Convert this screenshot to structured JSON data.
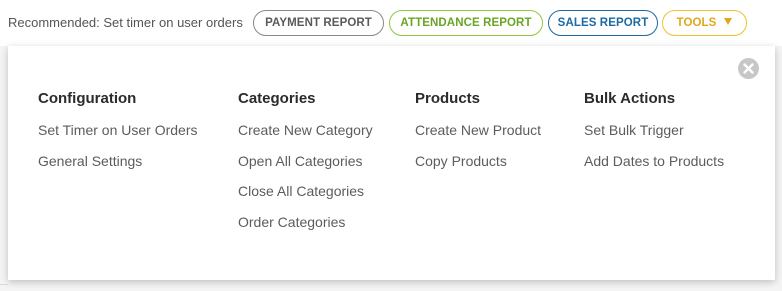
{
  "topbar": {
    "recommended_text": "Recommended: Set timer on user orders",
    "buttons": {
      "payment_report": "PAYMENT REPORT",
      "attendance_report": "ATTENDANCE REPORT",
      "sales_report": "SALES REPORT",
      "tools": "TOOLS"
    },
    "colors": {
      "payment": "#8a8a8a",
      "attendance": "#8fc73e",
      "sales": "#1c6aa3",
      "tools": "#f0c131"
    }
  },
  "panel": {
    "close_icon": "close-icon",
    "columns": [
      {
        "heading": "Configuration",
        "items": [
          "Set Timer on User Orders",
          "General Settings"
        ]
      },
      {
        "heading": "Categories",
        "items": [
          "Create New Category",
          "Open All Categories",
          "Close All Categories",
          "Order Categories"
        ]
      },
      {
        "heading": "Products",
        "items": [
          "Create New Product",
          "Copy Products"
        ]
      },
      {
        "heading": "Bulk Actions",
        "items": [
          "Set Bulk Trigger",
          "Add Dates to Products"
        ]
      }
    ]
  }
}
